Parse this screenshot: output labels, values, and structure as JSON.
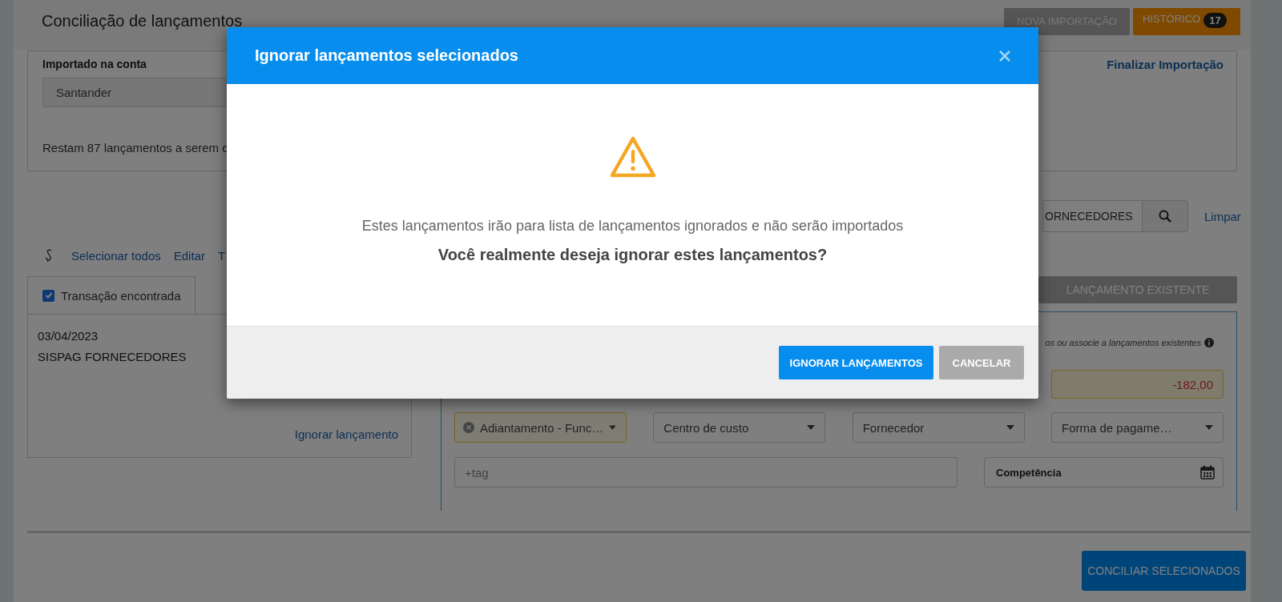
{
  "header": {
    "title": "Conciliação de lançamentos",
    "new_import_button": "NOVA IMPORTAÇÃO",
    "history_button": {
      "label": "HISTÓRICO",
      "count": "17"
    }
  },
  "import_card": {
    "account_label": "Importado na conta",
    "account_value": "Santander",
    "finish_link": "Finalizar Importação",
    "remaining_text": "Restam 87 lançamentos a serem c"
  },
  "search": {
    "value": "ORNECEDORES",
    "clear_link": "Limpar"
  },
  "toolbar": {
    "links": [
      "Selecionar todos",
      "Editar",
      "T"
    ]
  },
  "transaction": {
    "tab_label": "Transação encontrada",
    "checked": true,
    "date": "03/04/2023",
    "description": "SISPAG FORNECEDORES",
    "ignore_link": "Ignorar lançamento"
  },
  "existing": {
    "tab_label": "LANÇAMENTO EXISTENTE",
    "hint": "os ou associe a lançamentos existentes",
    "amount": "-182,00",
    "selects": [
      {
        "value": "Adiantamento - Func…",
        "filled": true
      },
      {
        "value": "Centro de custo",
        "filled": false
      },
      {
        "value": "Fornecedor",
        "filled": false
      },
      {
        "value": "Forma de pagame…",
        "filled": false
      }
    ],
    "tag_placeholder": "+tag",
    "competence_label": "Competência"
  },
  "footer": {
    "reconcile_button": "CONCILIAR SELECIONADOS"
  },
  "dialog": {
    "title": "Ignorar lançamentos selecionados",
    "message": "Estes lançamentos irão para lista de lançamentos ignorados e não serão importados",
    "question": "Você realmente deseja ignorar estes lançamentos?",
    "buttons": [
      {
        "label": "IGNORAR LANÇAMENTOS",
        "kind": "primary"
      },
      {
        "label": "CANCELAR",
        "kind": "secondary"
      }
    ]
  }
}
